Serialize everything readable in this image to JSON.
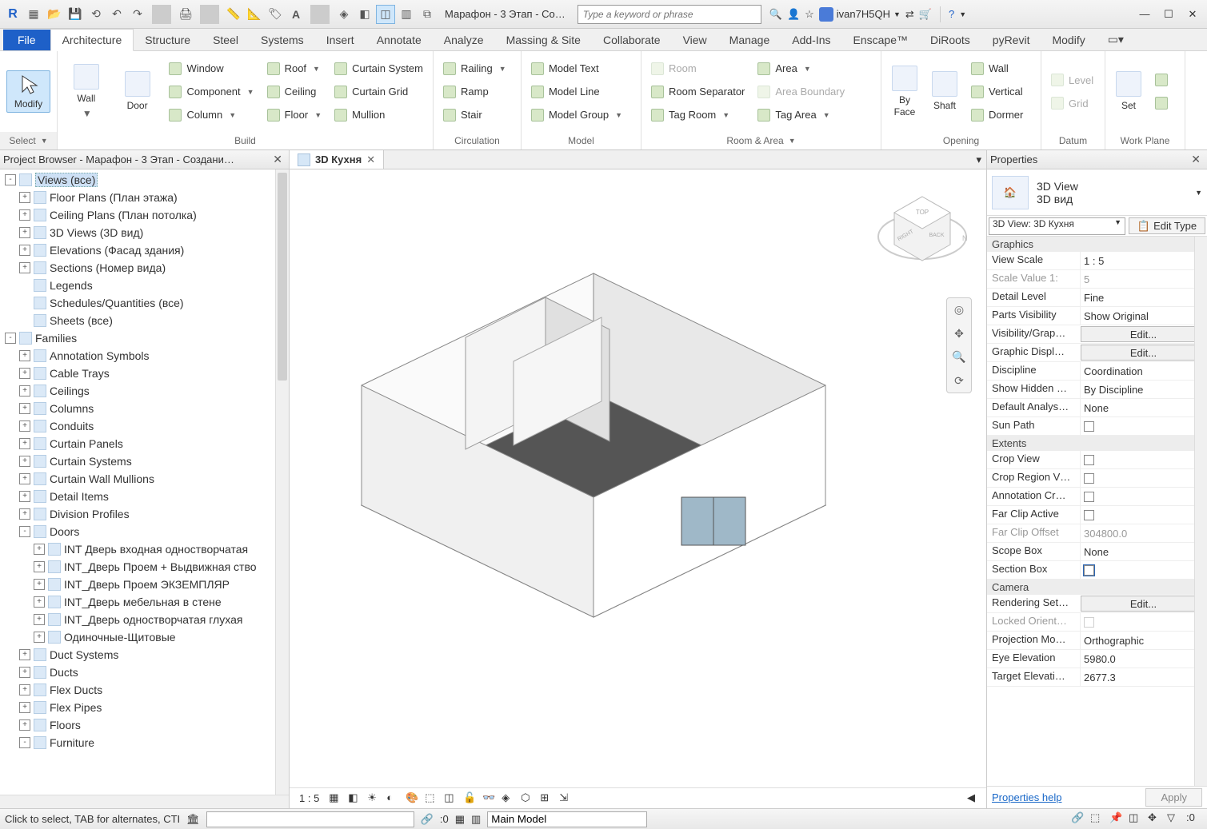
{
  "titlebar": {
    "title": "Марафон - 3 Этап - Со…",
    "search_placeholder": "Type a keyword or phrase",
    "username": "ivan7H5QH"
  },
  "tabs": {
    "file": "File",
    "items": [
      "Architecture",
      "Structure",
      "Steel",
      "Systems",
      "Insert",
      "Annotate",
      "Analyze",
      "Massing & Site",
      "Collaborate",
      "View",
      "Manage",
      "Add-Ins",
      "Enscape™",
      "DiRoots",
      "pyRevit",
      "Modify"
    ],
    "active": "Architecture"
  },
  "ribbon": {
    "select": {
      "modify": "Modify",
      "label": "Select"
    },
    "build": {
      "wall": "Wall",
      "door": "Door",
      "window": "Window",
      "component": "Component",
      "column": "Column",
      "roof": "Roof",
      "ceiling": "Ceiling",
      "floor": "Floor",
      "curtain_system": "Curtain System",
      "curtain_grid": "Curtain Grid",
      "mullion": "Mullion",
      "label": "Build"
    },
    "circulation": {
      "railing": "Railing",
      "ramp": "Ramp",
      "stair": "Stair",
      "label": "Circulation"
    },
    "model": {
      "model_text": "Model Text",
      "model_line": "Model Line",
      "model_group": "Model Group",
      "label": "Model"
    },
    "room_area": {
      "room": "Room",
      "room_separator": "Room Separator",
      "tag_room": "Tag Room",
      "area": "Area",
      "area_boundary": "Area Boundary",
      "tag_area": "Tag Area",
      "label": "Room & Area"
    },
    "opening": {
      "by_face": "By\nFace",
      "shaft": "Shaft",
      "wall": "Wall",
      "vertical": "Vertical",
      "dormer": "Dormer",
      "label": "Opening"
    },
    "datum": {
      "level": "Level",
      "grid": "Grid",
      "label": "Datum"
    },
    "work_plane": {
      "set": "Set",
      "label": "Work Plane"
    }
  },
  "browser": {
    "title": "Project Browser - Марафон - 3 Этап - Создани…",
    "views_root": "Views (все)",
    "views": [
      "Floor Plans (План этажа)",
      "Ceiling Plans (План потолка)",
      "3D Views (3D вид)",
      "Elevations (Фасад здания)",
      "Sections (Номер вида)"
    ],
    "legends": "Legends",
    "schedules": "Schedules/Quantities (все)",
    "sheets": "Sheets (все)",
    "families": "Families",
    "family_cats": [
      "Annotation Symbols",
      "Cable Trays",
      "Ceilings",
      "Columns",
      "Conduits",
      "Curtain Panels",
      "Curtain Systems",
      "Curtain Wall Mullions",
      "Detail Items",
      "Division Profiles"
    ],
    "doors": "Doors",
    "door_types": [
      "INT Дверь входная одностворчатая",
      "INT_Дверь Проем + Выдвижная ство",
      "INT_Дверь Проем ЭКЗЕМПЛЯР",
      "INT_Дверь мебельная в стене",
      "INT_Дверь одностворчатая глухая",
      "Одиночные-Щитовые"
    ],
    "more_cats": [
      "Duct Systems",
      "Ducts",
      "Flex Ducts",
      "Flex Pipes",
      "Floors",
      "Furniture"
    ]
  },
  "viewtab": {
    "name": "3D Кухня"
  },
  "view_control": {
    "scale": "1 : 5"
  },
  "props": {
    "title": "Properties",
    "type_cat": "3D View",
    "type_name": "3D вид",
    "instance_selector": "3D View: 3D Кухня",
    "edit_type": "Edit Type",
    "edit": "Edit...",
    "groups": {
      "graphics": "Graphics",
      "extents": "Extents",
      "camera": "Camera"
    },
    "rows": {
      "view_scale": {
        "k": "View Scale",
        "v": "1 : 5"
      },
      "scale_value": {
        "k": "Scale Value   1:",
        "v": "5"
      },
      "detail_level": {
        "k": "Detail Level",
        "v": "Fine"
      },
      "parts_visibility": {
        "k": "Parts Visibility",
        "v": "Show Original"
      },
      "visibility_graphics": {
        "k": "Visibility/Grap…"
      },
      "graphic_display": {
        "k": "Graphic Displ…"
      },
      "discipline": {
        "k": "Discipline",
        "v": "Coordination"
      },
      "show_hidden": {
        "k": "Show Hidden …",
        "v": "By Discipline"
      },
      "default_analysis": {
        "k": "Default Analys…",
        "v": "None"
      },
      "sun_path": {
        "k": "Sun Path"
      },
      "crop_view": {
        "k": "Crop View"
      },
      "crop_region_v": {
        "k": "Crop Region V…"
      },
      "annotation_cr": {
        "k": "Annotation Cr…"
      },
      "far_clip_active": {
        "k": "Far Clip Active"
      },
      "far_clip_offset": {
        "k": "Far Clip Offset",
        "v": "304800.0"
      },
      "scope_box": {
        "k": "Scope Box",
        "v": "None"
      },
      "section_box": {
        "k": "Section Box"
      },
      "rendering_set": {
        "k": "Rendering Set…"
      },
      "locked_orient": {
        "k": "Locked Orient…"
      },
      "projection_mode": {
        "k": "Projection Mo…",
        "v": "Orthographic"
      },
      "eye_elevation": {
        "k": "Eye Elevation",
        "v": "5980.0"
      },
      "target_elevation": {
        "k": "Target Elevati…",
        "v": "2677.3"
      }
    },
    "help": "Properties help",
    "apply": "Apply"
  },
  "status": {
    "hint": "Click to select, TAB for alternates, CTI",
    "zero": ":0",
    "worksets": "Main Model"
  }
}
